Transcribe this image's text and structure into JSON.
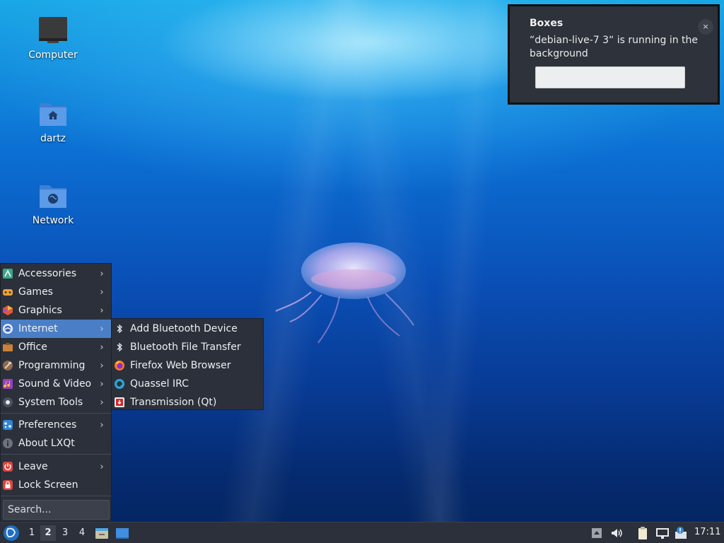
{
  "desktop": {
    "icons": [
      {
        "label": "Computer",
        "icon": "monitor-icon"
      },
      {
        "label": "dartz",
        "icon": "home-folder-icon"
      },
      {
        "label": "Network",
        "icon": "network-folder-icon"
      }
    ]
  },
  "notification": {
    "app_name": "Boxes",
    "message": "“debian-live-7 3“ is running in the background",
    "close_glyph": "×"
  },
  "menu": {
    "categories": [
      {
        "label": "Accessories",
        "icon": "accessories-icon"
      },
      {
        "label": "Games",
        "icon": "games-icon"
      },
      {
        "label": "Graphics",
        "icon": "graphics-icon"
      },
      {
        "label": "Internet",
        "icon": "internet-icon",
        "active": true
      },
      {
        "label": "Office",
        "icon": "office-icon"
      },
      {
        "label": "Programming",
        "icon": "programming-icon"
      },
      {
        "label": "Sound & Video",
        "icon": "sound-video-icon"
      },
      {
        "label": "System Tools",
        "icon": "system-tools-icon"
      }
    ],
    "preferences": "Preferences",
    "about": "About LXQt",
    "leave": "Leave",
    "lock": "Lock Screen",
    "search_placeholder": "Search...",
    "arrow_glyph": "›"
  },
  "internet_submenu": [
    {
      "label": "Add Bluetooth Device",
      "icon": "bluetooth-icon"
    },
    {
      "label": "Bluetooth File Transfer",
      "icon": "bluetooth-icon"
    },
    {
      "label": "Firefox Web Browser",
      "icon": "firefox-icon"
    },
    {
      "label": "Quassel IRC",
      "icon": "quassel-icon"
    },
    {
      "label": "Transmission (Qt)",
      "icon": "transmission-icon"
    }
  ],
  "taskbar": {
    "workspaces": [
      "1",
      "2",
      "3",
      "4"
    ],
    "current_workspace": "2",
    "clock": "17:11"
  },
  "colors": {
    "menu_bg": "#2b303a",
    "menu_highlight": "#4a7fc7",
    "panel_bg": "#2b303a"
  }
}
